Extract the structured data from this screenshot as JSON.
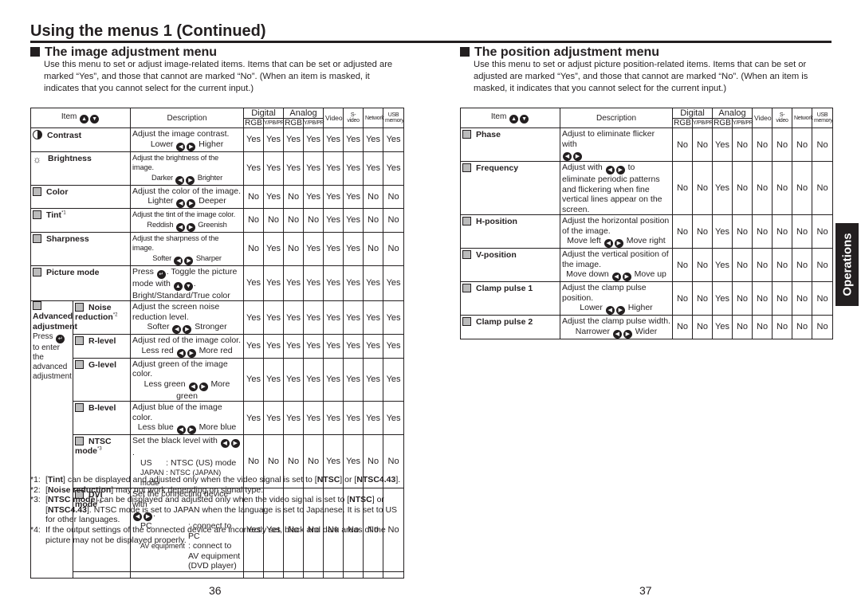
{
  "page": {
    "title": "Using the menus 1 (Continued)",
    "page_left": "36",
    "page_right": "37",
    "side_tab": "Operations"
  },
  "columns": {
    "item": "Item",
    "description": "Description",
    "digital": "Digital",
    "analog": "Analog",
    "rgb": "RGB",
    "ypbpr": "Y/PB/PR",
    "video": "Video",
    "svideo": "S-video",
    "network": "Network",
    "usb": "USB memory"
  },
  "icons": {
    "up": "up-button-icon",
    "down": "down-button-icon",
    "left": "left-button-icon",
    "right": "right-button-icon",
    "enter": "enter-button-icon"
  },
  "image_menu": {
    "heading": "The image adjustment menu",
    "intro": "Use this menu to set or adjust image-related items. Items that can be set or adjusted are marked “Yes”, and those that cannot are marked “No”. (When an item is masked, it indicates that you cannot select for the current input.)",
    "rows": [
      {
        "icon": "contrast-icon",
        "name": "Contrast",
        "desc": "Adjust the image contrast.",
        "left": "Lower",
        "right": "Higher",
        "values": [
          "Yes",
          "Yes",
          "Yes",
          "Yes",
          "Yes",
          "Yes",
          "Yes",
          "Yes"
        ]
      },
      {
        "icon": "brightness-icon",
        "name": "Brightness",
        "desc": "Adjust the brightness of the image.",
        "left": "Darker",
        "right": "Brighter",
        "values": [
          "Yes",
          "Yes",
          "Yes",
          "Yes",
          "Yes",
          "Yes",
          "Yes",
          "Yes"
        ]
      },
      {
        "icon": "color-icon",
        "name": "Color",
        "desc": "Adjust the color of the image.",
        "left": "Lighter",
        "right": "Deeper",
        "values": [
          "No",
          "Yes",
          "No",
          "Yes",
          "Yes",
          "Yes",
          "No",
          "No"
        ]
      },
      {
        "icon": "tint-icon",
        "name": "Tint",
        "note": "*1",
        "desc": "Adjust the tint of the image color.",
        "left": "Reddish",
        "right": "Greenish",
        "values": [
          "No",
          "No",
          "No",
          "No",
          "Yes",
          "Yes",
          "No",
          "No"
        ]
      },
      {
        "icon": "sharpness-icon",
        "name": "Sharpness",
        "desc": "Adjust the sharpness of the image.",
        "left": "Softer",
        "right": "Sharper",
        "values": [
          "No",
          "Yes",
          "No",
          "Yes",
          "Yes",
          "Yes",
          "No",
          "No"
        ]
      },
      {
        "icon": "picture-mode-icon",
        "name": "Picture mode",
        "desc_a": "Press",
        "desc_b": ". Toggle the picture mode with",
        "desc_c": "Bright/Standard/True color",
        "values": [
          "Yes",
          "Yes",
          "Yes",
          "Yes",
          "Yes",
          "Yes",
          "Yes",
          "Yes"
        ]
      }
    ],
    "advanced": {
      "title": "Advanced adjustment",
      "press": "Press",
      "hint": "to enter the advanced adjustment",
      "rows": [
        {
          "icon": "noise-reduction-icon",
          "name": "Noise reduction",
          "note": "*2",
          "desc": "Adjust the screen noise reduction level.",
          "left": "Softer",
          "right": "Stronger",
          "values": [
            "Yes",
            "Yes",
            "Yes",
            "Yes",
            "Yes",
            "Yes",
            "Yes",
            "Yes"
          ]
        },
        {
          "icon": "r-level-icon",
          "name": "R-level",
          "desc": "Adjust red of the image color.",
          "left": "Less red",
          "right": "More red",
          "values": [
            "Yes",
            "Yes",
            "Yes",
            "Yes",
            "Yes",
            "Yes",
            "Yes",
            "Yes"
          ]
        },
        {
          "icon": "g-level-icon",
          "name": "G-level",
          "desc": "Adjust green of the image color.",
          "left": "Less green",
          "right": "More green",
          "values": [
            "Yes",
            "Yes",
            "Yes",
            "Yes",
            "Yes",
            "Yes",
            "Yes",
            "Yes"
          ]
        },
        {
          "icon": "b-level-icon",
          "name": "B-level",
          "desc": "Adjust blue of the image color.",
          "left": "Less blue",
          "right": "More blue",
          "values": [
            "Yes",
            "Yes",
            "Yes",
            "Yes",
            "Yes",
            "Yes",
            "Yes",
            "Yes"
          ]
        },
        {
          "icon": "ntsc-mode-icon",
          "name": "NTSC mode",
          "note": "*3",
          "desc": "Set the black level with",
          "opt1": "US      : NTSC (US) mode",
          "opt2": "JAPAN : NTSC (JAPAN) mode",
          "values": [
            "No",
            "No",
            "No",
            "No",
            "Yes",
            "Yes",
            "No",
            "No"
          ]
        },
        {
          "icon": "dvi-mode-icon",
          "name": "DVI mode",
          "note": "*4",
          "desc": "Set the connecting device with",
          "opt1_k": "PC",
          "opt1_v": ": connect to PC",
          "opt2_k": "AV equipment",
          "opt2_v": ": connect to AV equipment (DVD player)",
          "values": [
            "Yes",
            "Yes",
            "No",
            "No",
            "No",
            "No",
            "No",
            "No"
          ]
        }
      ]
    },
    "footnotes": [
      {
        "key": "*1:",
        "parts": [
          "",
          "Tint",
          "] can be displayed and adjusted only when the video signal is set to [",
          "NTSC",
          "] or [",
          "NTSC4.43",
          "]."
        ]
      },
      {
        "key": "*2:",
        "parts": [
          "",
          "Noise reduction",
          "] may not work depending on signal type."
        ]
      },
      {
        "key": "*3:",
        "parts": [
          "",
          "NTSC mode",
          "] can be displayed and adjusted only when the video signal is set to [",
          "NTSC",
          "] or [",
          "NTSC4.43",
          "]. NTSC mode is set to JAPAN when the language is set to Japanese. It is set to US for other languages."
        ]
      },
      {
        "key": "*4:",
        "text": "If the output settings of the connected device are incorrectly set, black and dark areas of the picture may not be displayed properly."
      }
    ]
  },
  "position_menu": {
    "heading": "The position adjustment menu",
    "intro": "Use this menu to set or adjust picture position-related items. Items that can be set or adjusted are marked “Yes”, and those that cannot are marked “No”. (When an item is masked, it indicates that you cannot select for the current input.)",
    "rows": [
      {
        "icon": "phase-icon",
        "name": "Phase",
        "desc": "Adjust to eliminate flicker with",
        "values": [
          "No",
          "No",
          "Yes",
          "No",
          "No",
          "No",
          "No",
          "No"
        ]
      },
      {
        "icon": "frequency-icon",
        "name": "Frequency",
        "desc_a": "Adjust with",
        "desc_b": "to eliminate periodic patterns and flickering when fine vertical lines appear on the screen.",
        "values": [
          "No",
          "No",
          "Yes",
          "No",
          "No",
          "No",
          "No",
          "No"
        ]
      },
      {
        "icon": "h-position-icon",
        "name": "H-position",
        "desc": "Adjust the horizontal position of the image.",
        "left": "Move left",
        "right": "Move right",
        "values": [
          "No",
          "No",
          "Yes",
          "No",
          "No",
          "No",
          "No",
          "No"
        ]
      },
      {
        "icon": "v-position-icon",
        "name": "V-position",
        "desc": "Adjust the vertical position of the image.",
        "left": "Move down",
        "right": "Move up",
        "values": [
          "No",
          "No",
          "Yes",
          "No",
          "No",
          "No",
          "No",
          "No"
        ]
      },
      {
        "icon": "clamp-pulse-1-icon",
        "name": "Clamp pulse 1",
        "desc": "Adjust the clamp pulse position.",
        "left": "Lower",
        "right": "Higher",
        "values": [
          "No",
          "No",
          "Yes",
          "No",
          "No",
          "No",
          "No",
          "No"
        ]
      },
      {
        "icon": "clamp-pulse-2-icon",
        "name": "Clamp pulse 2",
        "desc": "Adjust the clamp pulse width.",
        "left": "Narrower",
        "right": "Wider",
        "values": [
          "No",
          "No",
          "Yes",
          "No",
          "No",
          "No",
          "No",
          "No"
        ]
      }
    ]
  }
}
